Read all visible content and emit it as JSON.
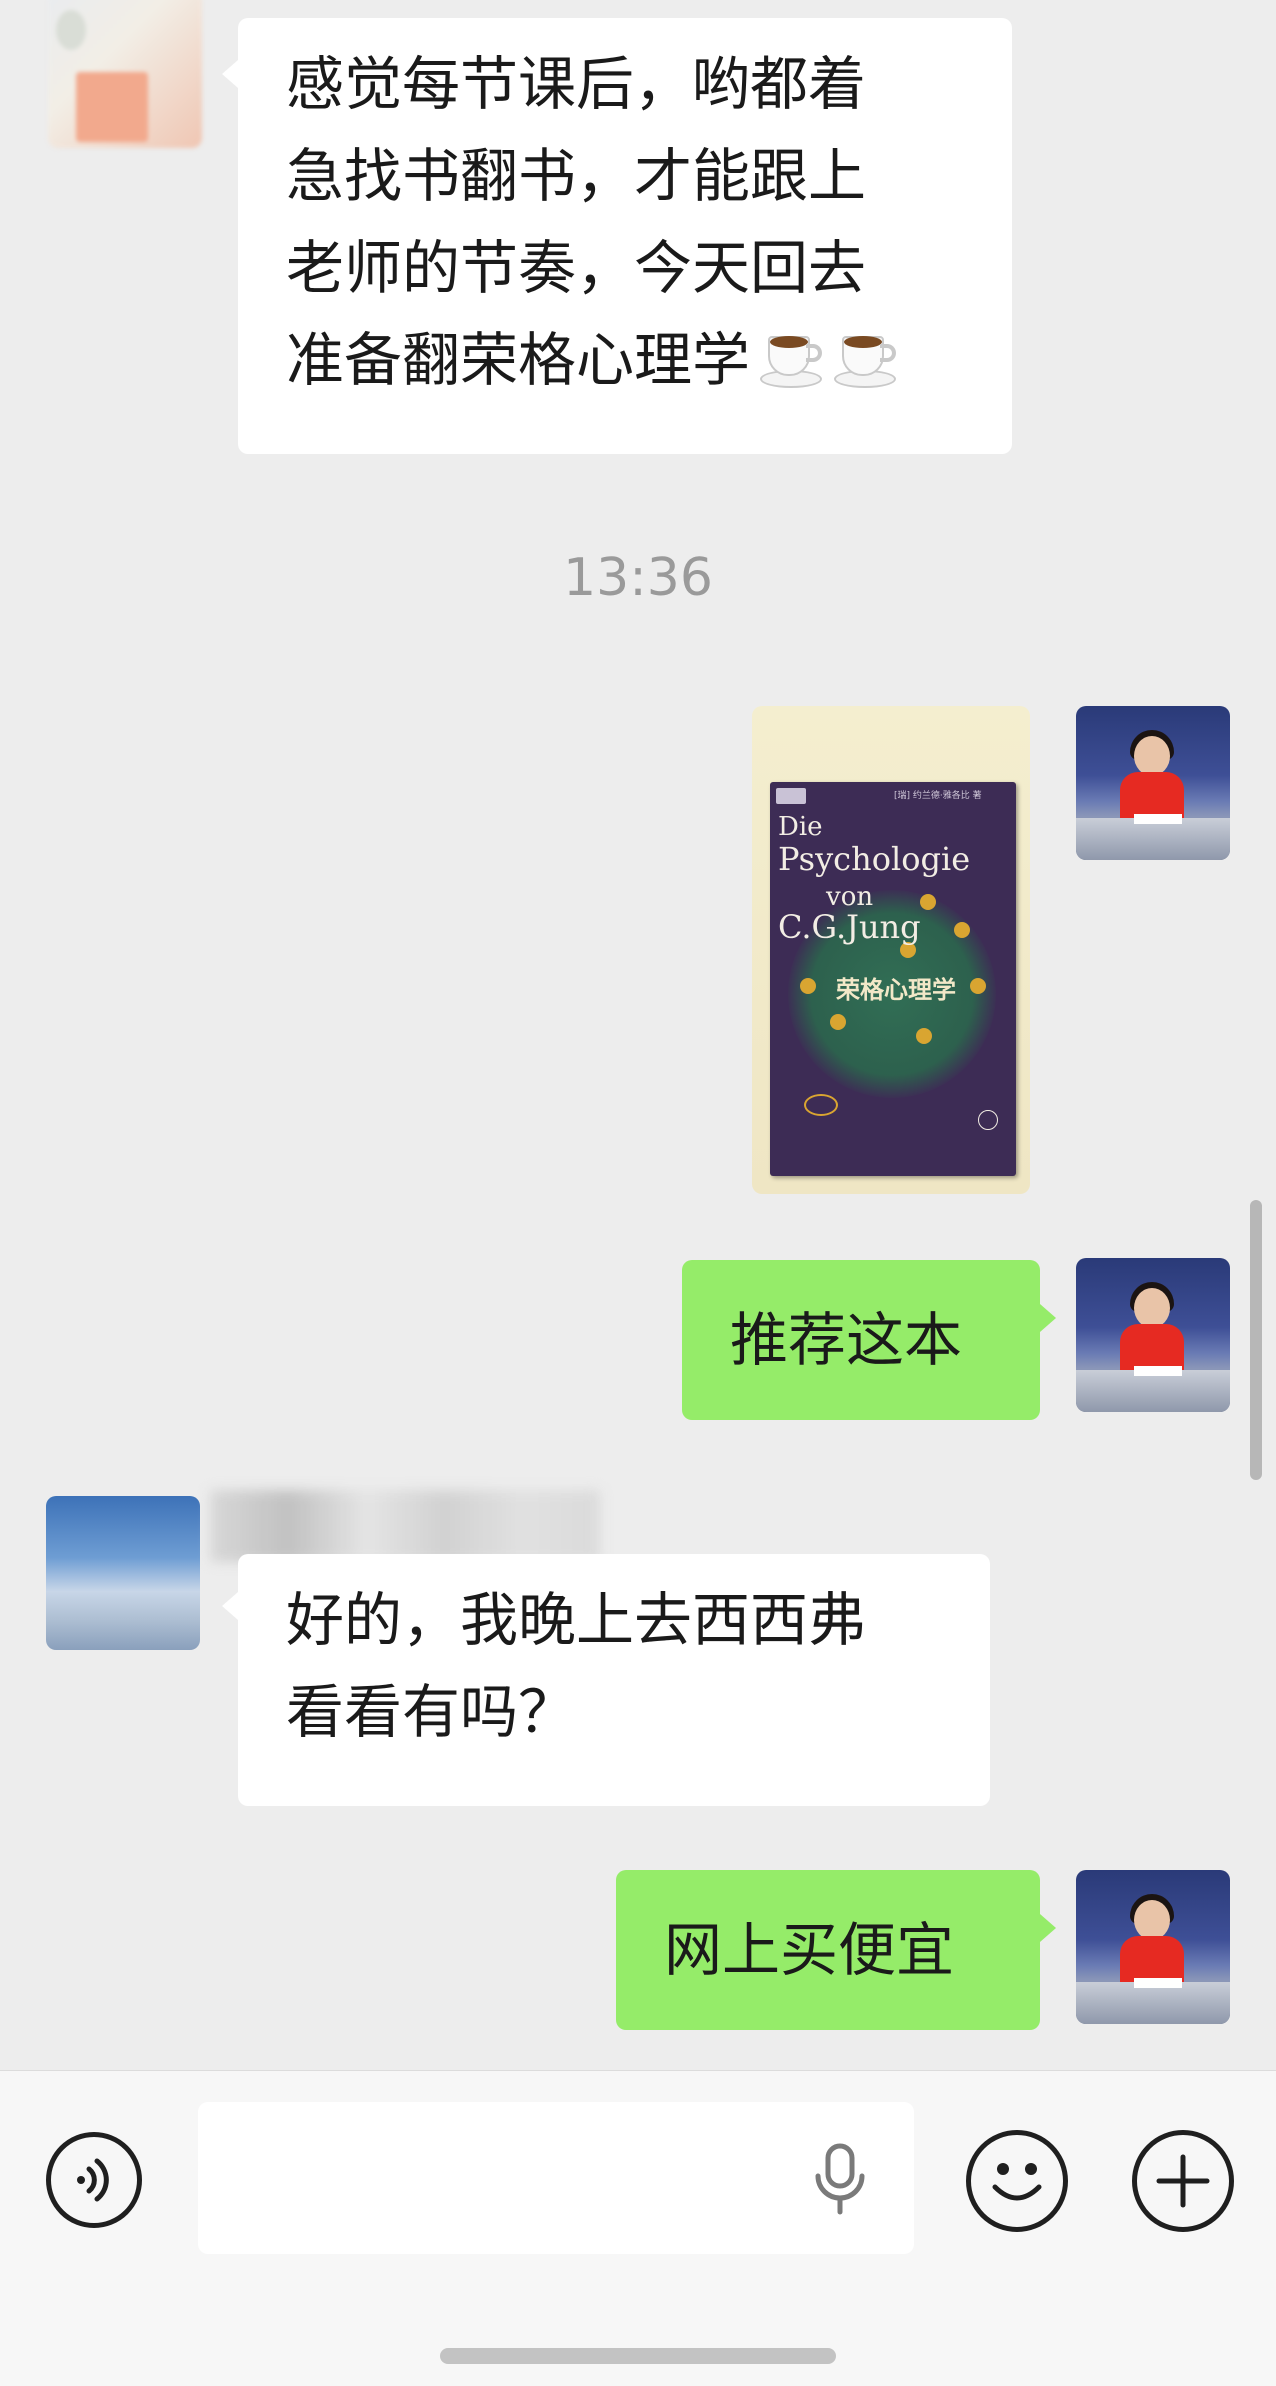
{
  "messages": [
    {
      "sender": "other",
      "lines": [
        "感觉每节课后，哟都着",
        "急找书翻书，才能跟上",
        "老师的节奏，今天回去",
        "准备翻荣格心理学"
      ],
      "emoji": [
        "hot-beverage",
        "hot-beverage"
      ]
    },
    {
      "timestamp": "13:36"
    },
    {
      "sender": "self",
      "image": {
        "type": "book-photo",
        "author_line": "[瑞] 约兰德·雅各比 著",
        "title_de_1": "Die",
        "title_de_2": "Psychologie",
        "title_de_3": "von",
        "title_de_4": "C.G.Jung",
        "title_cn": "荣格心理学"
      }
    },
    {
      "sender": "self",
      "text": "推荐这本"
    },
    {
      "sender": "other",
      "lines": [
        "好的，我晚上去西西弗",
        "看看有吗？"
      ]
    },
    {
      "sender": "self",
      "text": "网上买便宜"
    }
  ],
  "input_bar": {
    "voice_icon": "voice-icon",
    "mic_icon": "microphone-icon",
    "emoji_icon": "smiley-icon",
    "more_icon": "plus-icon"
  },
  "colors": {
    "background": "#ededed",
    "incoming_bubble": "#ffffff",
    "outgoing_bubble": "#95ec69",
    "timestamp": "#9a9a9a"
  }
}
